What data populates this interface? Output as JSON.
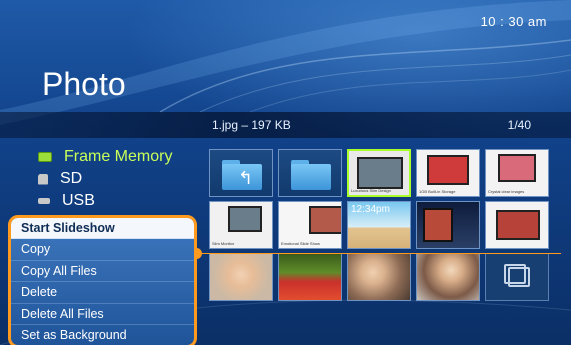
{
  "header": {
    "time": "10 : 30 am",
    "title": "Photo"
  },
  "info_bar": {
    "filename": "1.jpg – 197 KB",
    "page": "1/40"
  },
  "sources": [
    {
      "label": "Frame Memory",
      "icon": "frame-memory-icon",
      "active": true
    },
    {
      "label": "SD",
      "icon": "sd-card-icon",
      "active": false
    },
    {
      "label": "USB",
      "icon": "usb-icon",
      "active": false
    }
  ],
  "menu": {
    "items": [
      "Start Slideshow",
      "Copy",
      "Copy All Files",
      "Delete",
      "Delete All Files",
      "Set as Background"
    ]
  },
  "thumbnails": {
    "row1_c2_label": "Luxurious Slim Design",
    "row1_c3_label": "1GB Built-in Storage",
    "row1_c4_label": "Crystal clear images",
    "row2_c0_label": "Slim Monitor",
    "row2_c1_label": "Emotional Slide Show",
    "row2_c2_time": "12:34pm"
  },
  "colors": {
    "accent": "#ff9a1f",
    "selected": "#a8ff2a",
    "active_source": "#c8ff5a"
  }
}
